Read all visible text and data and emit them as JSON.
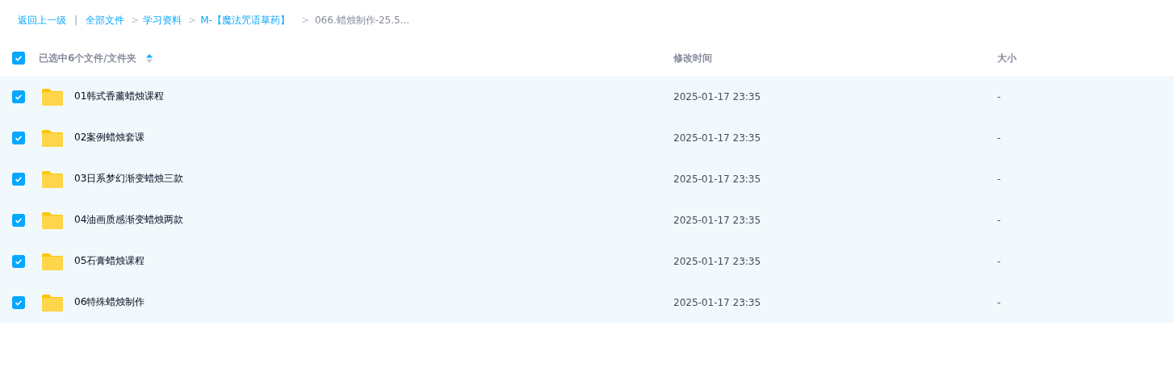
{
  "breadcrumb": [
    {
      "kind": "link",
      "text": "返回上一级"
    },
    {
      "kind": "divider",
      "text": "|"
    },
    {
      "kind": "link",
      "text": "全部文件"
    },
    {
      "kind": "separator",
      "text": ">"
    },
    {
      "kind": "link",
      "text": "学习资料"
    },
    {
      "kind": "separator",
      "text": ">"
    },
    {
      "kind": "link",
      "text": "M-【魔法咒语草药】"
    },
    {
      "kind": "separator",
      "text": ">"
    },
    {
      "kind": "current",
      "text": "066.蜡烛制作-25.5..."
    }
  ],
  "table": {
    "select_all": {
      "checked": true,
      "label": "已选中6个文件/文件夹"
    },
    "columns": [
      "修改时间",
      "大小"
    ],
    "rows": [
      {
        "name": "01韩式香薰蜡烛课程",
        "modified": "2025-01-17 23:35",
        "size": "-",
        "selected": true
      },
      {
        "name": "02案例蜡烛套课",
        "modified": "2025-01-17 23:35",
        "size": "-",
        "selected": true
      },
      {
        "name": "03日系梦幻渐变蜡烛三款",
        "modified": "2025-01-17 23:35",
        "size": "-",
        "selected": true
      },
      {
        "name": "04油画质感渐变蜡烛两款",
        "modified": "2025-01-17 23:35",
        "size": "-",
        "selected": true
      },
      {
        "name": "05石膏蜡烛课程",
        "modified": "2025-01-17 23:35",
        "size": "-",
        "selected": true
      },
      {
        "name": "06特殊蜡烛制作",
        "modified": "2025-01-17 23:35",
        "size": "-",
        "selected": true
      }
    ]
  }
}
